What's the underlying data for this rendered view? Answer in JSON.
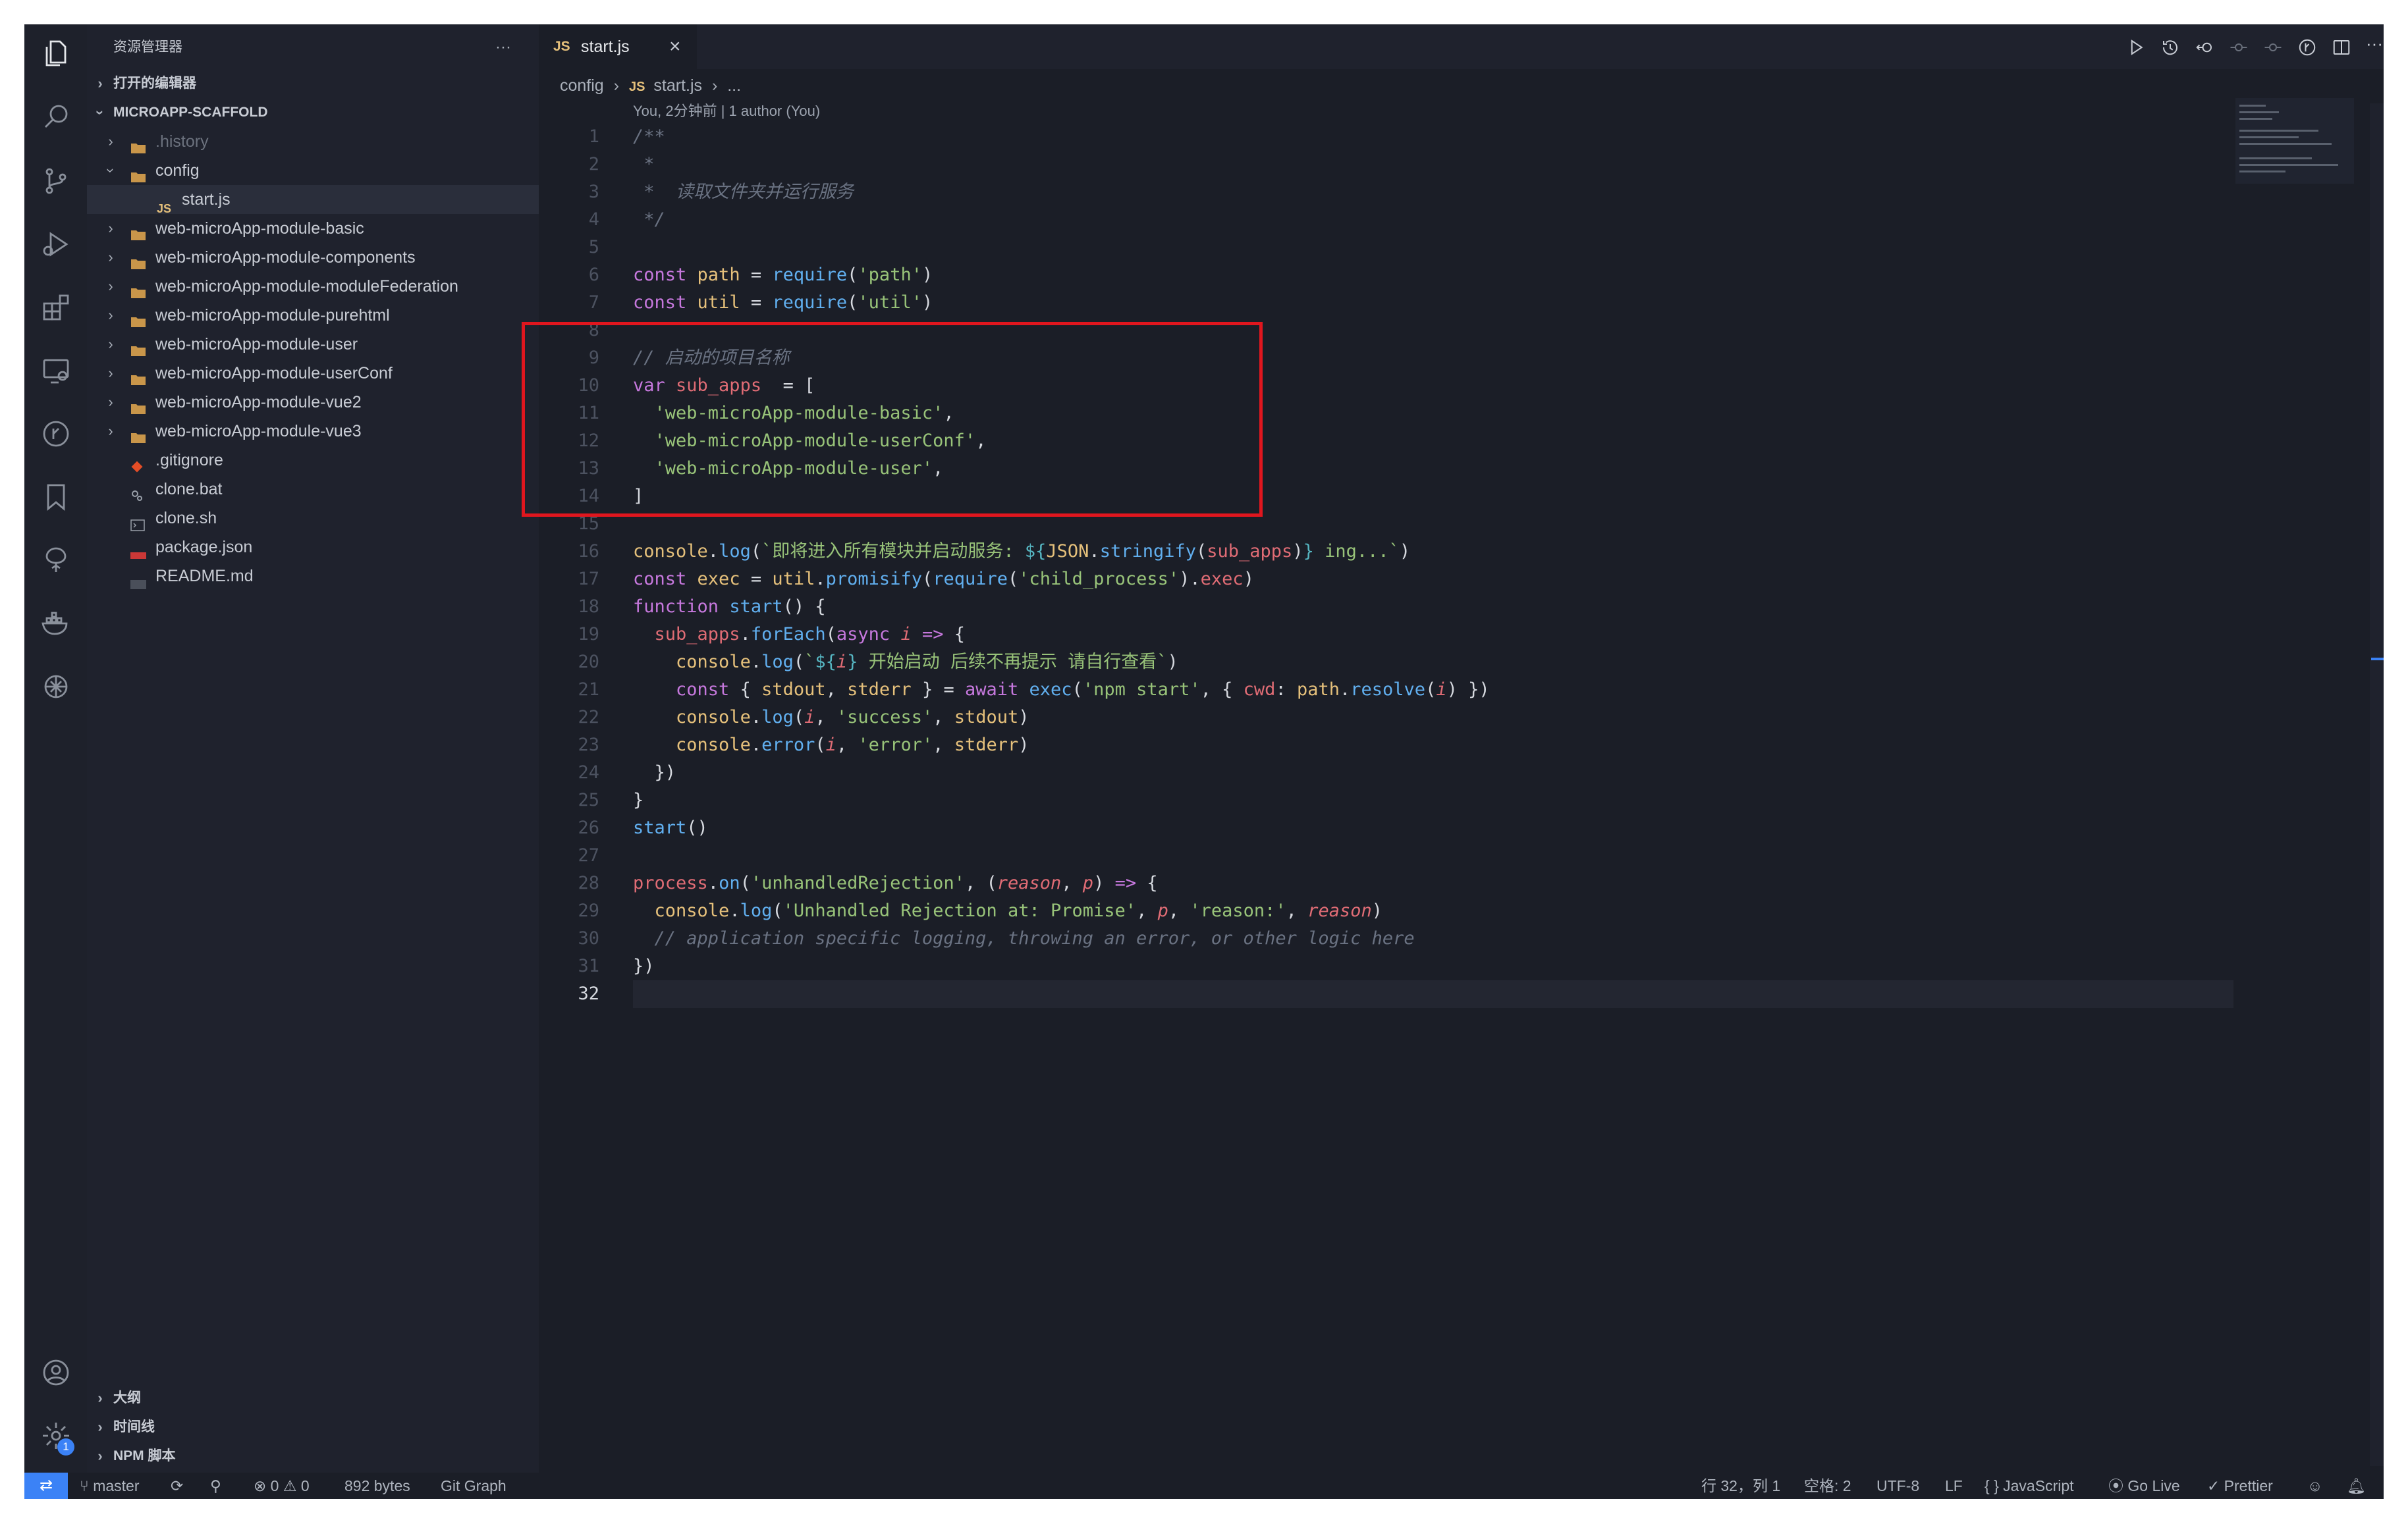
{
  "sidebar": {
    "title": "资源管理器",
    "more": "···",
    "open_editors": "打开的编辑器",
    "project": "MICROAPP-SCAFFOLD",
    "tree": [
      {
        "name": ".history",
        "type": "folder",
        "depth": 1,
        "expanded": false,
        "dim": true
      },
      {
        "name": "config",
        "type": "folder",
        "depth": 1,
        "expanded": true
      },
      {
        "name": "start.js",
        "type": "js",
        "depth": 2,
        "selected": true
      },
      {
        "name": "web-microApp-module-basic",
        "type": "folder",
        "depth": 1
      },
      {
        "name": "web-microApp-module-components",
        "type": "folder",
        "depth": 1
      },
      {
        "name": "web-microApp-module-moduleFederation",
        "type": "folder",
        "depth": 1
      },
      {
        "name": "web-microApp-module-purehtml",
        "type": "folder",
        "depth": 1
      },
      {
        "name": "web-microApp-module-user",
        "type": "folder",
        "depth": 1
      },
      {
        "name": "web-microApp-module-userConf",
        "type": "folder",
        "depth": 1
      },
      {
        "name": "web-microApp-module-vue2",
        "type": "folder",
        "depth": 1
      },
      {
        "name": "web-microApp-module-vue3",
        "type": "folder",
        "depth": 1
      },
      {
        "name": ".gitignore",
        "type": "git",
        "depth": 1
      },
      {
        "name": "clone.bat",
        "type": "gear",
        "depth": 1
      },
      {
        "name": "clone.sh",
        "type": "shell",
        "depth": 1
      },
      {
        "name": "package.json",
        "type": "npm",
        "depth": 1
      },
      {
        "name": "README.md",
        "type": "md",
        "depth": 1
      }
    ],
    "bottom_sections": [
      "大纲",
      "时间线",
      "NPM 脚本"
    ]
  },
  "tab": {
    "lang": "JS",
    "filename": "start.js",
    "close": "×"
  },
  "breadcrumb": {
    "folder": "config",
    "lang": "JS",
    "file": "start.js",
    "tail": "..."
  },
  "blame": "You, 2分钟前 | 1 author (You)",
  "code_lines": [
    [
      [
        "cm",
        "/**"
      ]
    ],
    [
      [
        "cm",
        " *"
      ]
    ],
    [
      [
        "cm",
        " *  读取文件夹并运行服务"
      ]
    ],
    [
      [
        "cm",
        " */"
      ]
    ],
    [],
    [
      [
        "kw",
        "const "
      ],
      [
        "vr",
        "path"
      ],
      [
        "tx",
        " = "
      ],
      [
        "fn",
        "require"
      ],
      [
        "tx",
        "("
      ],
      [
        "st",
        "'path'"
      ],
      [
        "tx",
        ")"
      ]
    ],
    [
      [
        "kw",
        "const "
      ],
      [
        "vr",
        "util"
      ],
      [
        "tx",
        " = "
      ],
      [
        "fn",
        "require"
      ],
      [
        "tx",
        "("
      ],
      [
        "st",
        "'util'"
      ],
      [
        "tx",
        ")"
      ]
    ],
    [],
    [
      [
        "cm",
        "// 启动的项目名称"
      ]
    ],
    [
      [
        "kw",
        "var "
      ],
      [
        "pr",
        "sub_apps"
      ],
      [
        "tx",
        "  = ["
      ]
    ],
    [
      [
        "tx",
        "  "
      ],
      [
        "st",
        "'web-microApp-module-basic'"
      ],
      [
        "tx",
        ","
      ]
    ],
    [
      [
        "tx",
        "  "
      ],
      [
        "st",
        "'web-microApp-module-userConf'"
      ],
      [
        "tx",
        ","
      ]
    ],
    [
      [
        "tx",
        "  "
      ],
      [
        "st",
        "'web-microApp-module-user'"
      ],
      [
        "tx",
        ","
      ]
    ],
    [
      [
        "tx",
        "]"
      ]
    ],
    [],
    [
      [
        "vr",
        "console"
      ],
      [
        "tx",
        "."
      ],
      [
        "fn",
        "log"
      ],
      [
        "tx",
        "("
      ],
      [
        "st",
        "`即将进入所有模块并启动服务: "
      ],
      [
        "op",
        "${"
      ],
      [
        "vr",
        "JSON"
      ],
      [
        "tx",
        "."
      ],
      [
        "fn",
        "stringify"
      ],
      [
        "tx",
        "("
      ],
      [
        "pr",
        "sub_apps"
      ],
      [
        "tx",
        ")"
      ],
      [
        "op",
        "}"
      ],
      [
        "st",
        " ing...`"
      ],
      [
        "tx",
        ")"
      ]
    ],
    [
      [
        "kw",
        "const "
      ],
      [
        "vr",
        "exec"
      ],
      [
        "tx",
        " = "
      ],
      [
        "vr",
        "util"
      ],
      [
        "tx",
        "."
      ],
      [
        "fn",
        "promisify"
      ],
      [
        "tx",
        "("
      ],
      [
        "fn",
        "require"
      ],
      [
        "tx",
        "("
      ],
      [
        "st",
        "'child_process'"
      ],
      [
        "tx",
        ")."
      ],
      [
        "pr",
        "exec"
      ],
      [
        "tx",
        ")"
      ]
    ],
    [
      [
        "kw",
        "function "
      ],
      [
        "fn",
        "start"
      ],
      [
        "tx",
        "() {"
      ]
    ],
    [
      [
        "tx",
        "  "
      ],
      [
        "pr",
        "sub_apps"
      ],
      [
        "tx",
        "."
      ],
      [
        "fn",
        "forEach"
      ],
      [
        "tx",
        "("
      ],
      [
        "kw",
        "async "
      ],
      [
        "it",
        "i"
      ],
      [
        "kw",
        " => "
      ],
      [
        "tx",
        "{"
      ]
    ],
    [
      [
        "tx",
        "    "
      ],
      [
        "vr",
        "console"
      ],
      [
        "tx",
        "."
      ],
      [
        "fn",
        "log"
      ],
      [
        "tx",
        "("
      ],
      [
        "st",
        "`"
      ],
      [
        "op",
        "${"
      ],
      [
        "it",
        "i"
      ],
      [
        "op",
        "}"
      ],
      [
        "st",
        " 开始启动 后续不再提示 请自行查看`"
      ],
      [
        "tx",
        ")"
      ]
    ],
    [
      [
        "tx",
        "    "
      ],
      [
        "kw",
        "const "
      ],
      [
        "tx",
        "{ "
      ],
      [
        "vr",
        "stdout"
      ],
      [
        "tx",
        ", "
      ],
      [
        "vr",
        "stderr"
      ],
      [
        "tx",
        " } = "
      ],
      [
        "kw",
        "await "
      ],
      [
        "fn",
        "exec"
      ],
      [
        "tx",
        "("
      ],
      [
        "st",
        "'npm start'"
      ],
      [
        "tx",
        ", { "
      ],
      [
        "pr",
        "cwd"
      ],
      [
        "tx",
        ": "
      ],
      [
        "vr",
        "path"
      ],
      [
        "tx",
        "."
      ],
      [
        "fn",
        "resolve"
      ],
      [
        "tx",
        "("
      ],
      [
        "it",
        "i"
      ],
      [
        "tx",
        ") })"
      ]
    ],
    [
      [
        "tx",
        "    "
      ],
      [
        "vr",
        "console"
      ],
      [
        "tx",
        "."
      ],
      [
        "fn",
        "log"
      ],
      [
        "tx",
        "("
      ],
      [
        "it",
        "i"
      ],
      [
        "tx",
        ", "
      ],
      [
        "st",
        "'success'"
      ],
      [
        "tx",
        ", "
      ],
      [
        "vr",
        "stdout"
      ],
      [
        "tx",
        ")"
      ]
    ],
    [
      [
        "tx",
        "    "
      ],
      [
        "vr",
        "console"
      ],
      [
        "tx",
        "."
      ],
      [
        "fn",
        "error"
      ],
      [
        "tx",
        "("
      ],
      [
        "it",
        "i"
      ],
      [
        "tx",
        ", "
      ],
      [
        "st",
        "'error'"
      ],
      [
        "tx",
        ", "
      ],
      [
        "vr",
        "stderr"
      ],
      [
        "tx",
        ")"
      ]
    ],
    [
      [
        "tx",
        "  })"
      ]
    ],
    [
      [
        "tx",
        "}"
      ]
    ],
    [
      [
        "fn",
        "start"
      ],
      [
        "tx",
        "()"
      ]
    ],
    [],
    [
      [
        "pr",
        "process"
      ],
      [
        "tx",
        "."
      ],
      [
        "fn",
        "on"
      ],
      [
        "tx",
        "("
      ],
      [
        "st",
        "'unhandledRejection'"
      ],
      [
        "tx",
        ", ("
      ],
      [
        "it",
        "reason"
      ],
      [
        "tx",
        ", "
      ],
      [
        "it",
        "p"
      ],
      [
        "tx",
        ") "
      ],
      [
        "kw",
        "=>"
      ],
      [
        "tx",
        " {"
      ]
    ],
    [
      [
        "tx",
        "  "
      ],
      [
        "vr",
        "console"
      ],
      [
        "tx",
        "."
      ],
      [
        "fn",
        "log"
      ],
      [
        "tx",
        "("
      ],
      [
        "st",
        "'Unhandled Rejection at: Promise'"
      ],
      [
        "tx",
        ", "
      ],
      [
        "it",
        "p"
      ],
      [
        "tx",
        ", "
      ],
      [
        "st",
        "'reason:'"
      ],
      [
        "tx",
        ", "
      ],
      [
        "it",
        "reason"
      ],
      [
        "tx",
        ")"
      ]
    ],
    [
      [
        "tx",
        "  "
      ],
      [
        "cm",
        "// application specific logging, throwing an error, or other logic here"
      ]
    ],
    [
      [
        "tx",
        "})"
      ]
    ],
    []
  ],
  "current_line": 32,
  "highlight_color": "#e0161e",
  "status": {
    "branch": "master",
    "problems": "⊗ 0 ⚠ 0",
    "size": "892 bytes",
    "git_graph": "Git Graph",
    "position": "行 32，列 1",
    "spaces": "空格: 2",
    "encoding": "UTF-8",
    "eol": "LF",
    "language": "{ } JavaScript",
    "go_live": "Go Live",
    "prettier": "Prettier",
    "settings_badge": "1"
  },
  "colors": {
    "accent": "#3b82f6",
    "bg": "#1b1e27",
    "sidebar": "#1f222d"
  }
}
